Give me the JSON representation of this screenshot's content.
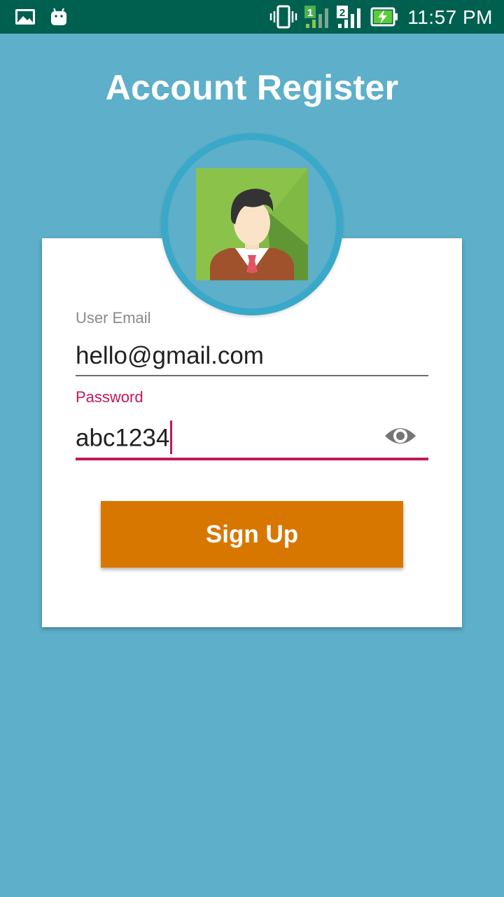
{
  "status_bar": {
    "time": "11:57 PM",
    "icons": [
      "gallery-icon",
      "android-icon",
      "vibrate-icon",
      "sim1-signal-icon",
      "sim2-signal-icon",
      "battery-charging-icon"
    ],
    "sim1_label": "1",
    "sim2_label": "2"
  },
  "page": {
    "title": "Account Register"
  },
  "form": {
    "email_label": "User Email",
    "email_value": "hello@gmail.com",
    "password_label": "Password",
    "password_value": "abc1234",
    "signup_label": "Sign Up"
  },
  "colors": {
    "background": "#5eafc9",
    "status_bar": "#006050",
    "accent": "#c2185b",
    "button": "#d87700",
    "avatar_ring": "#3aa8c9"
  }
}
